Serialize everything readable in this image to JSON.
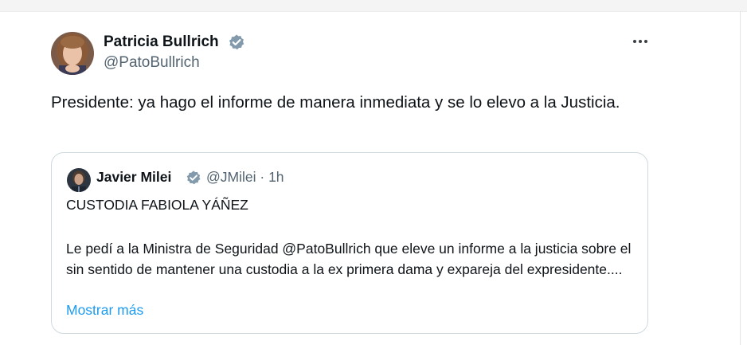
{
  "post": {
    "author": {
      "name": "Patricia Bullrich",
      "handle": "@PatoBullrich",
      "verified": true
    },
    "text": "Presidente: ya hago el informe de manera inmediata y se lo elevo a la Justicia.",
    "more_icon": "ellipsis-icon"
  },
  "quoted_post": {
    "author": {
      "name": "Javier Milei",
      "handle": "@JMilei",
      "verified": true
    },
    "separator": "·",
    "time": "1h",
    "headline": "CUSTODIA FABIOLA YÁÑEZ",
    "body": "Le pedí a la Ministra de Seguridad @PatoBullrich que eleve un informe a la justicia sobre el sin sentido de mantener una custodia a la ex primera dama y expareja del expresidente....",
    "show_more": "Mostrar más"
  },
  "colors": {
    "text_primary": "#0f1419",
    "text_secondary": "#536471",
    "link": "#1d9bf0",
    "verified_badge": "#829aab",
    "card_border": "#cfd9de"
  }
}
